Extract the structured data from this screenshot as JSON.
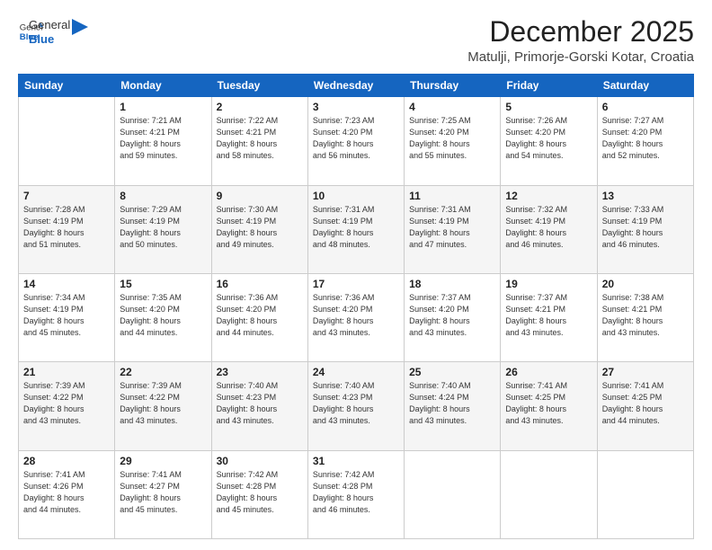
{
  "logo": {
    "general": "General",
    "blue": "Blue"
  },
  "header": {
    "title": "December 2025",
    "subtitle": "Matulji, Primorje-Gorski Kotar, Croatia"
  },
  "weekdays": [
    "Sunday",
    "Monday",
    "Tuesday",
    "Wednesday",
    "Thursday",
    "Friday",
    "Saturday"
  ],
  "weeks": [
    [
      {
        "day": "",
        "sunrise": "",
        "sunset": "",
        "daylight": ""
      },
      {
        "day": "1",
        "sunrise": "Sunrise: 7:21 AM",
        "sunset": "Sunset: 4:21 PM",
        "daylight": "Daylight: 8 hours and 59 minutes."
      },
      {
        "day": "2",
        "sunrise": "Sunrise: 7:22 AM",
        "sunset": "Sunset: 4:21 PM",
        "daylight": "Daylight: 8 hours and 58 minutes."
      },
      {
        "day": "3",
        "sunrise": "Sunrise: 7:23 AM",
        "sunset": "Sunset: 4:20 PM",
        "daylight": "Daylight: 8 hours and 56 minutes."
      },
      {
        "day": "4",
        "sunrise": "Sunrise: 7:25 AM",
        "sunset": "Sunset: 4:20 PM",
        "daylight": "Daylight: 8 hours and 55 minutes."
      },
      {
        "day": "5",
        "sunrise": "Sunrise: 7:26 AM",
        "sunset": "Sunset: 4:20 PM",
        "daylight": "Daylight: 8 hours and 54 minutes."
      },
      {
        "day": "6",
        "sunrise": "Sunrise: 7:27 AM",
        "sunset": "Sunset: 4:20 PM",
        "daylight": "Daylight: 8 hours and 52 minutes."
      }
    ],
    [
      {
        "day": "7",
        "sunrise": "Sunrise: 7:28 AM",
        "sunset": "Sunset: 4:19 PM",
        "daylight": "Daylight: 8 hours and 51 minutes."
      },
      {
        "day": "8",
        "sunrise": "Sunrise: 7:29 AM",
        "sunset": "Sunset: 4:19 PM",
        "daylight": "Daylight: 8 hours and 50 minutes."
      },
      {
        "day": "9",
        "sunrise": "Sunrise: 7:30 AM",
        "sunset": "Sunset: 4:19 PM",
        "daylight": "Daylight: 8 hours and 49 minutes."
      },
      {
        "day": "10",
        "sunrise": "Sunrise: 7:31 AM",
        "sunset": "Sunset: 4:19 PM",
        "daylight": "Daylight: 8 hours and 48 minutes."
      },
      {
        "day": "11",
        "sunrise": "Sunrise: 7:31 AM",
        "sunset": "Sunset: 4:19 PM",
        "daylight": "Daylight: 8 hours and 47 minutes."
      },
      {
        "day": "12",
        "sunrise": "Sunrise: 7:32 AM",
        "sunset": "Sunset: 4:19 PM",
        "daylight": "Daylight: 8 hours and 46 minutes."
      },
      {
        "day": "13",
        "sunrise": "Sunrise: 7:33 AM",
        "sunset": "Sunset: 4:19 PM",
        "daylight": "Daylight: 8 hours and 46 minutes."
      }
    ],
    [
      {
        "day": "14",
        "sunrise": "Sunrise: 7:34 AM",
        "sunset": "Sunset: 4:19 PM",
        "daylight": "Daylight: 8 hours and 45 minutes."
      },
      {
        "day": "15",
        "sunrise": "Sunrise: 7:35 AM",
        "sunset": "Sunset: 4:20 PM",
        "daylight": "Daylight: 8 hours and 44 minutes."
      },
      {
        "day": "16",
        "sunrise": "Sunrise: 7:36 AM",
        "sunset": "Sunset: 4:20 PM",
        "daylight": "Daylight: 8 hours and 44 minutes."
      },
      {
        "day": "17",
        "sunrise": "Sunrise: 7:36 AM",
        "sunset": "Sunset: 4:20 PM",
        "daylight": "Daylight: 8 hours and 43 minutes."
      },
      {
        "day": "18",
        "sunrise": "Sunrise: 7:37 AM",
        "sunset": "Sunset: 4:20 PM",
        "daylight": "Daylight: 8 hours and 43 minutes."
      },
      {
        "day": "19",
        "sunrise": "Sunrise: 7:37 AM",
        "sunset": "Sunset: 4:21 PM",
        "daylight": "Daylight: 8 hours and 43 minutes."
      },
      {
        "day": "20",
        "sunrise": "Sunrise: 7:38 AM",
        "sunset": "Sunset: 4:21 PM",
        "daylight": "Daylight: 8 hours and 43 minutes."
      }
    ],
    [
      {
        "day": "21",
        "sunrise": "Sunrise: 7:39 AM",
        "sunset": "Sunset: 4:22 PM",
        "daylight": "Daylight: 8 hours and 43 minutes."
      },
      {
        "day": "22",
        "sunrise": "Sunrise: 7:39 AM",
        "sunset": "Sunset: 4:22 PM",
        "daylight": "Daylight: 8 hours and 43 minutes."
      },
      {
        "day": "23",
        "sunrise": "Sunrise: 7:40 AM",
        "sunset": "Sunset: 4:23 PM",
        "daylight": "Daylight: 8 hours and 43 minutes."
      },
      {
        "day": "24",
        "sunrise": "Sunrise: 7:40 AM",
        "sunset": "Sunset: 4:23 PM",
        "daylight": "Daylight: 8 hours and 43 minutes."
      },
      {
        "day": "25",
        "sunrise": "Sunrise: 7:40 AM",
        "sunset": "Sunset: 4:24 PM",
        "daylight": "Daylight: 8 hours and 43 minutes."
      },
      {
        "day": "26",
        "sunrise": "Sunrise: 7:41 AM",
        "sunset": "Sunset: 4:25 PM",
        "daylight": "Daylight: 8 hours and 43 minutes."
      },
      {
        "day": "27",
        "sunrise": "Sunrise: 7:41 AM",
        "sunset": "Sunset: 4:25 PM",
        "daylight": "Daylight: 8 hours and 44 minutes."
      }
    ],
    [
      {
        "day": "28",
        "sunrise": "Sunrise: 7:41 AM",
        "sunset": "Sunset: 4:26 PM",
        "daylight": "Daylight: 8 hours and 44 minutes."
      },
      {
        "day": "29",
        "sunrise": "Sunrise: 7:41 AM",
        "sunset": "Sunset: 4:27 PM",
        "daylight": "Daylight: 8 hours and 45 minutes."
      },
      {
        "day": "30",
        "sunrise": "Sunrise: 7:42 AM",
        "sunset": "Sunset: 4:28 PM",
        "daylight": "Daylight: 8 hours and 45 minutes."
      },
      {
        "day": "31",
        "sunrise": "Sunrise: 7:42 AM",
        "sunset": "Sunset: 4:28 PM",
        "daylight": "Daylight: 8 hours and 46 minutes."
      },
      {
        "day": "",
        "sunrise": "",
        "sunset": "",
        "daylight": ""
      },
      {
        "day": "",
        "sunrise": "",
        "sunset": "",
        "daylight": ""
      },
      {
        "day": "",
        "sunrise": "",
        "sunset": "",
        "daylight": ""
      }
    ]
  ]
}
